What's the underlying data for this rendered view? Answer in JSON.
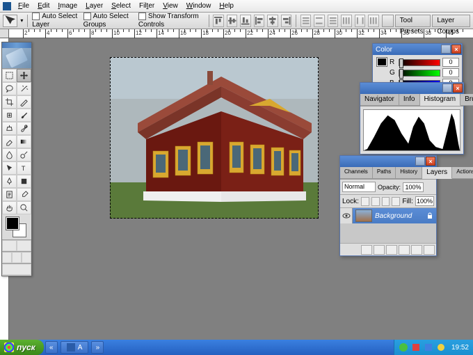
{
  "menu": {
    "items": [
      "File",
      "Edit",
      "Image",
      "Layer",
      "Select",
      "Filter",
      "View",
      "Window",
      "Help"
    ]
  },
  "options_bar": {
    "auto_select_layer": "Auto Select Layer",
    "auto_select_groups": "Auto Select Groups",
    "show_transform": "Show Transform Controls",
    "well_tabs": [
      "Tool Presets",
      "Layer Comps"
    ]
  },
  "ruler": {
    "h_labels": [
      "2",
      "4",
      "6",
      "8",
      "10",
      "12",
      "14",
      "16",
      "18",
      "20",
      "22",
      "24",
      "26",
      "28",
      "30",
      "32",
      "34",
      "36",
      "38",
      "40"
    ]
  },
  "toolbox": {
    "fg_color": "#000000",
    "bg_color": "#ffffff"
  },
  "color_panel": {
    "title": "Color",
    "channels": [
      {
        "label": "R",
        "value": 0
      },
      {
        "label": "G",
        "value": 0
      },
      {
        "label": "B",
        "value": 0
      }
    ]
  },
  "histogram_panel": {
    "tabs": [
      "Navigator",
      "Info",
      "Histogram",
      "Brushes"
    ],
    "active": 2
  },
  "layers_panel": {
    "tabs": [
      "Channels",
      "Paths",
      "History",
      "Layers",
      "Actions"
    ],
    "active": 3,
    "blend_mode": "Normal",
    "opacity_label": "Opacity:",
    "opacity": "100%",
    "lock_label": "Lock:",
    "fill_label": "Fill:",
    "fill": "100%",
    "layer": {
      "name": "Background",
      "locked": true,
      "visible": true
    }
  },
  "taskbar": {
    "start": "пуск",
    "tasks": [
      {
        "label": "A"
      }
    ],
    "clock": "19:52"
  }
}
